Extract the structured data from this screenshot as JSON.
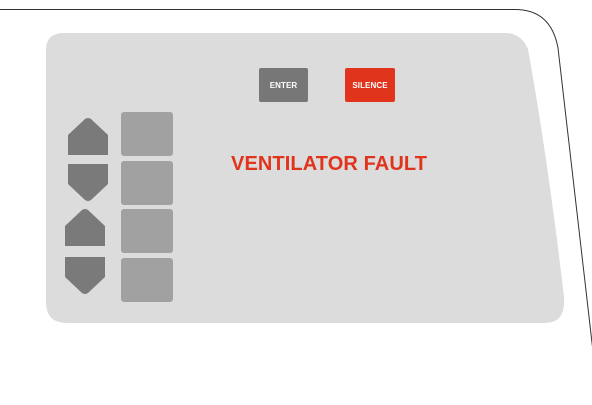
{
  "panel": {
    "enter_label": "ENTER",
    "silence_label": "SILENCE",
    "status_message": "VENTILATOR FAULT"
  },
  "colors": {
    "panel_background": "#dcdcdc",
    "enter_button": "#777777",
    "silence_button": "#e0341c",
    "status_text": "#e0341c",
    "soft_key": "#a1a1a1",
    "arrow_key": "#7a7a7a"
  },
  "icons": [
    "arrow-up-icon",
    "arrow-down-icon"
  ]
}
